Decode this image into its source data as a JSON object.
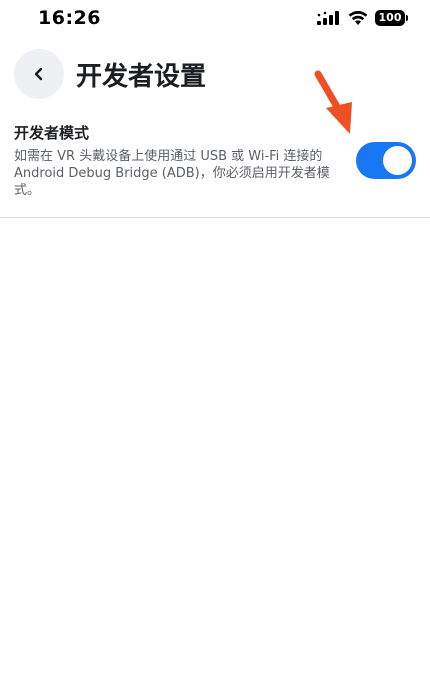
{
  "status_bar": {
    "time": "16:26",
    "battery": "100",
    "icons": [
      "signal-icon",
      "wifi-icon",
      "battery-icon"
    ]
  },
  "header": {
    "back_icon": "chevron-left-icon",
    "title": "开发者设置"
  },
  "developer_mode": {
    "title": "开发者模式",
    "description": "如需在 VR 头戴设备上使用通过 USB 或 Wi-Fi 连接的 Android Debug Bridge (ADB)，你必须启用开发者模式。",
    "enabled": true
  },
  "colors": {
    "toggle_on": "#1877f2",
    "annotation_arrow": "#f04e23",
    "back_button_bg": "#eef0f3"
  }
}
